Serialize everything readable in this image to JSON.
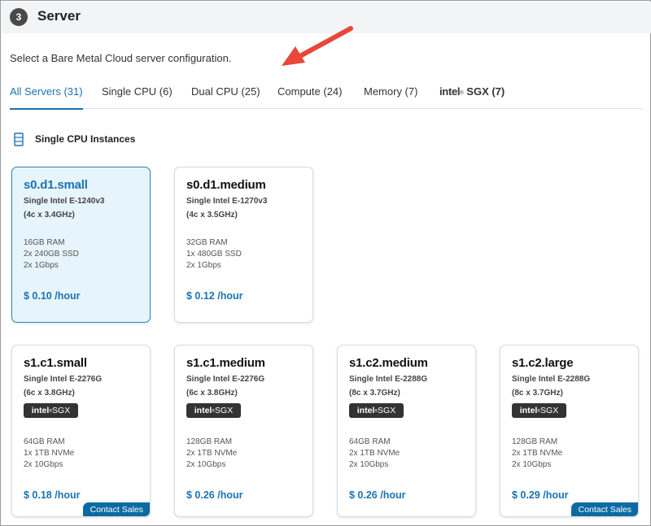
{
  "header": {
    "step": "3",
    "title": "Server"
  },
  "subtitle": "Select a Bare Metal Cloud server configuration.",
  "tabs": [
    {
      "label": "All Servers (31)",
      "active": true
    },
    {
      "label": "Single CPU (6)"
    },
    {
      "label": "Dual CPU (25)"
    },
    {
      "label": "Compute (24)"
    },
    {
      "label": "Memory (7)"
    },
    {
      "brand": "intel",
      "brand_mark": "®",
      "label": "SGX (7)"
    }
  ],
  "section": {
    "title": "Single CPU Instances",
    "icon": "server-icon"
  },
  "badge": {
    "brand": "intel",
    "mark": "®",
    "text": "SGX"
  },
  "contact_sales_label": "Contact Sales",
  "cards": [
    {
      "name": "s0.d1.small",
      "cpu": "Single Intel E-1240v3",
      "cores": "(4c x 3.4GHz)",
      "ram": "16GB RAM",
      "storage": "2x 240GB SSD",
      "network": "2x 1Gbps",
      "price": "$ 0.10 /hour",
      "selected": true
    },
    {
      "name": "s0.d1.medium",
      "cpu": "Single Intel E-1270v3",
      "cores": "(4c x 3.5GHz)",
      "ram": "32GB RAM",
      "storage": "1x 480GB SSD",
      "network": "2x 1Gbps",
      "price": "$ 0.12 /hour"
    },
    {
      "name": "s1.c1.small",
      "cpu": "Single Intel E-2276G",
      "cores": "(6c x 3.8GHz)",
      "ram": "64GB RAM",
      "storage": "1x 1TB NVMe",
      "network": "2x 10Gbps",
      "price": "$ 0.18 /hour",
      "contact_sales": true
    },
    {
      "name": "s1.c1.medium",
      "cpu": "Single Intel E-2276G",
      "cores": "(6c x 3.8GHz)",
      "ram": "128GB RAM",
      "storage": "2x 1TB NVMe",
      "network": "2x 10Gbps",
      "price": "$ 0.26 /hour"
    },
    {
      "name": "s1.c2.medium",
      "cpu": "Single Intel E-2288G",
      "cores": "(8c x 3.7GHz)",
      "ram": "64GB RAM",
      "storage": "2x 1TB NVMe",
      "network": "2x 10Gbps",
      "price": "$ 0.26 /hour"
    },
    {
      "name": "s1.c2.large",
      "cpu": "Single Intel E-2288G",
      "cores": "(8c x 3.7GHz)",
      "ram": "128GB RAM",
      "storage": "2x 1TB NVMe",
      "network": "2x 10Gbps",
      "price": "$ 0.29 /hour",
      "contact_sales": true
    }
  ],
  "colors": {
    "accent": "#1a73b0",
    "selected_bg": "#e6f4fb",
    "arrow": "#e8473a",
    "badge_bg": "#333333",
    "contact_bg": "#0c6aa3"
  }
}
